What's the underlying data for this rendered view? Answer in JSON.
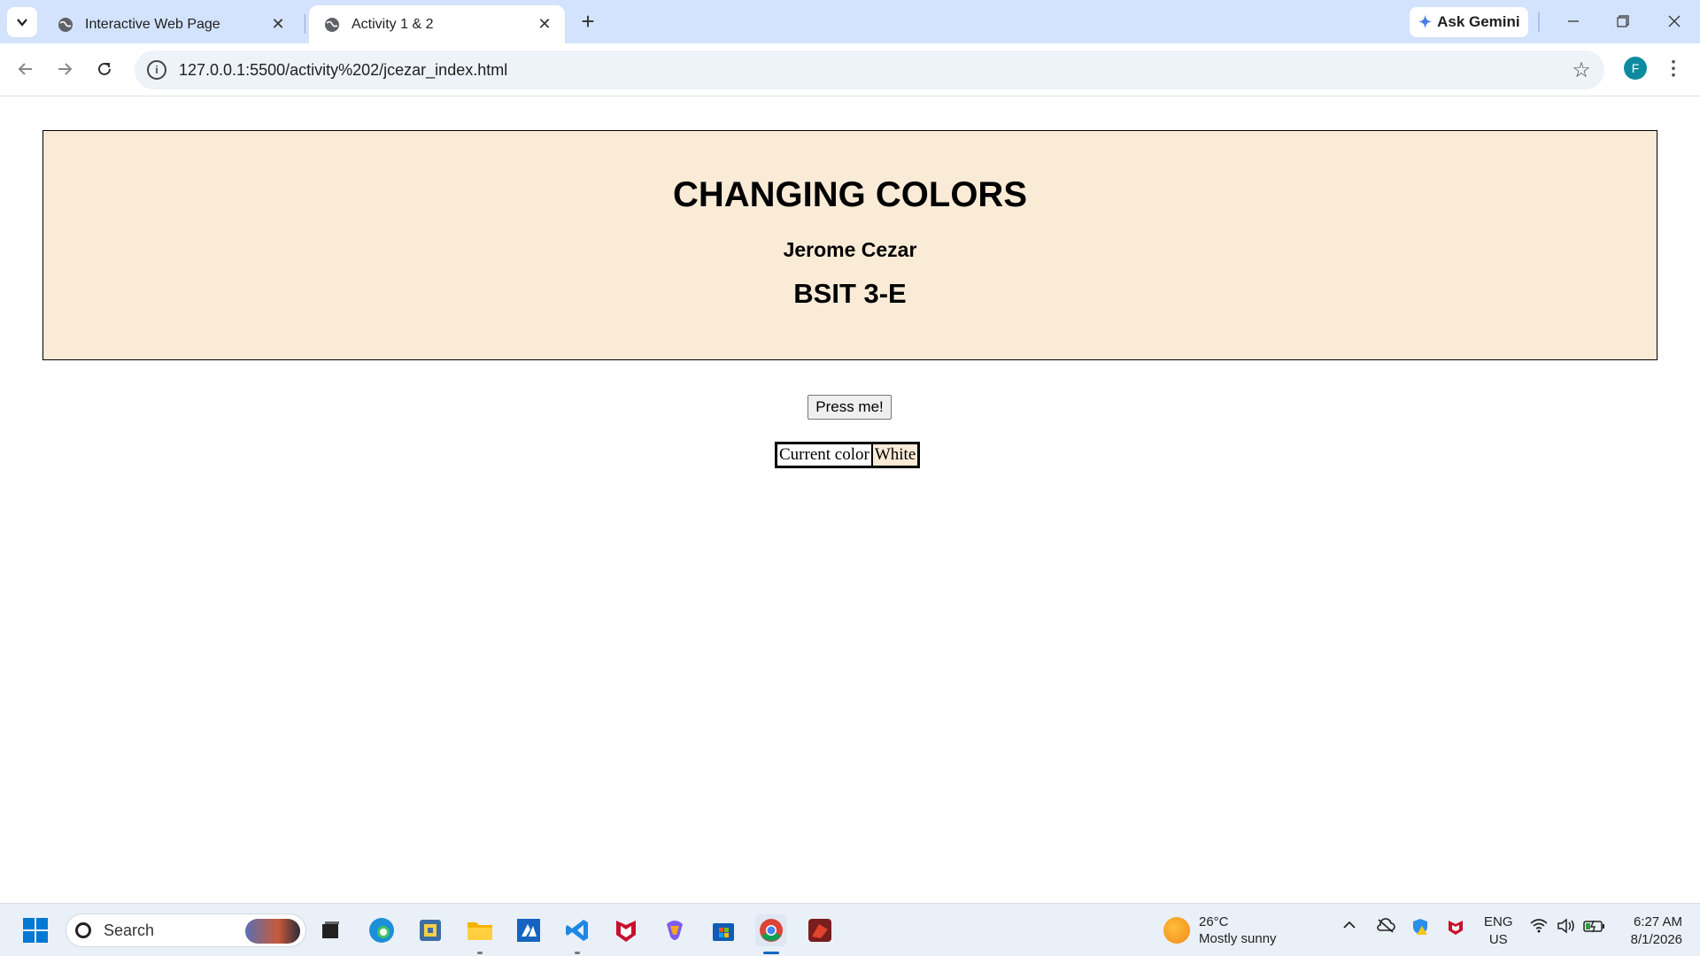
{
  "browser": {
    "tabs": [
      {
        "title": "Interactive Web Page",
        "active": false
      },
      {
        "title": "Activity 1 & 2",
        "active": true
      }
    ],
    "ask_gemini": "Ask Gemini",
    "url": "127.0.0.1:5500/activity%202/jcezar_index.html",
    "profile_initial": "F"
  },
  "page": {
    "heading": "CHANGING COLORS",
    "author": "Jerome Cezar",
    "section": "BSIT 3-E",
    "button_label": "Press me!",
    "color_label": "Current color",
    "color_value": "White",
    "header_bg": "#faebd7"
  },
  "taskbar": {
    "search_label": "Search",
    "weather_temp": "26°C",
    "weather_desc": "Mostly sunny",
    "lang_primary": "ENG",
    "lang_region": "US",
    "time": "6:27 AM",
    "date": "8/1/2026",
    "apps": [
      "file-explorer-icon",
      "edge-icon",
      "python-icon",
      "folder-icon",
      "azure-icon",
      "vscode-icon",
      "mcafee-icon",
      "copilot-icon",
      "store-icon",
      "chrome-icon",
      "game-icon"
    ]
  }
}
